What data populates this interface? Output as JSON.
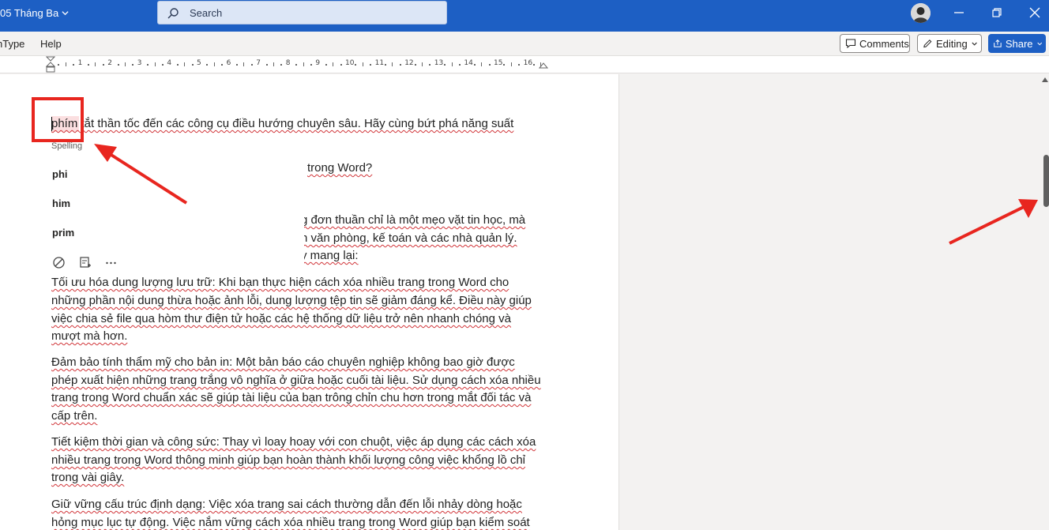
{
  "titlebar": {
    "doc_title": "05 Tháng Ba",
    "search_placeholder": "Search",
    "bg_color": "#1d5fc4"
  },
  "menu": {
    "items": [
      "nType",
      "Help"
    ],
    "comments_label": "Comments",
    "editing_label": "Editing",
    "share_label": "Share"
  },
  "ruler": {
    "numbers": [
      "1",
      "2",
      "3",
      "4",
      "5",
      "6",
      "7",
      "8",
      "9",
      "10",
      "11",
      "12",
      "13",
      "14",
      "15",
      "16"
    ]
  },
  "spelling": {
    "header": "Spelling",
    "suggestions": [
      "phi",
      "him",
      "prim"
    ],
    "misspelled_word": "phím"
  },
  "document": {
    "lines": [
      "phím tắt thần tốc đến các công cụ điều hướng chuyên sâu. Hãy cùng bứt phá năng suất",
      "trong Word?",
      "g đơn thuần chỉ là một mẹo vặt tin học, mà",
      "n văn phòng, kế toán và các nhà quản lý.",
      "y mang lại:",
      "Tối ưu hóa dung lượng lưu trữ: Khi bạn thực hiện cách xóa nhiều trang trong Word cho",
      "những phần nội dung thừa hoặc ảnh lỗi, dung lượng tệp tin sẽ giảm đáng kể. Điều này giúp",
      "việc chia sẻ file qua hòm thư điện tử hoặc các hệ thống dữ liệu trở nên nhanh chóng và",
      "mượt mà hơn.",
      "Đảm bảo tính thẩm mỹ cho bản in: Một bản báo cáo chuyên nghiệp không bao giờ được",
      "phép xuất hiện những trang trắng vô nghĩa ở giữa hoặc cuối tài liệu. Sử dụng cách xóa nhiều",
      "trang trong Word chuẩn xác sẽ giúp tài liệu của bạn trông chỉn chu hơn trong mắt đối tác và",
      "cấp trên.",
      "Tiết kiệm thời gian và công sức: Thay vì loay hoay với con chuột, việc áp dụng các cách xóa",
      "nhiều trang trong Word thông minh giúp bạn hoàn thành khối lượng công việc khổng lồ chỉ",
      "trong vài giây.",
      "Giữ vững cấu trúc định dạng: Việc xóa trang sai cách thường dẫn đến lỗi nhảy dòng hoặc",
      "hỏng mục lục tự động. Việc nắm vững cách xóa nhiều trang trong Word giúp bạn kiểm soát"
    ]
  },
  "colors": {
    "accent": "#1d5fc4",
    "annotation_red": "#e8261f",
    "squiggle": "#d13438"
  }
}
